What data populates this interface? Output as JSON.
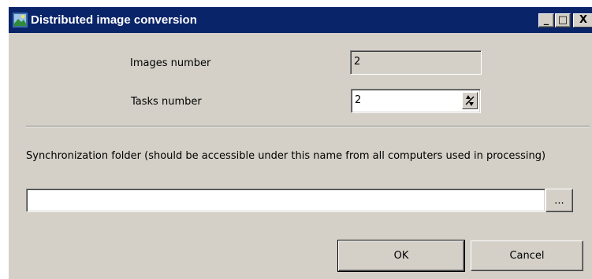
{
  "window": {
    "title": "Distributed image conversion",
    "icon": "image-conversion-app-icon",
    "controls": {
      "minimize": "_",
      "maximize": "□",
      "close": "X"
    }
  },
  "form": {
    "images_number": {
      "label": "Images number",
      "value": "2"
    },
    "tasks_number": {
      "label": "Tasks number",
      "value": "2"
    },
    "sync_folder": {
      "label": "Synchronization folder (should be accessible under this name from all computers used in processing)",
      "value": "",
      "browse_label": "..."
    }
  },
  "buttons": {
    "ok": "OK",
    "cancel": "Cancel"
  },
  "colors": {
    "titlebar": "#0a246a",
    "face": "#d4d0c8"
  }
}
